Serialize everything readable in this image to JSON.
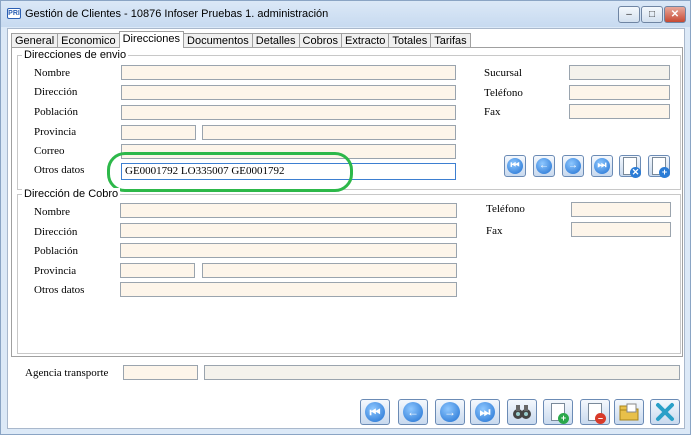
{
  "window": {
    "title": "Gestión de Clientes - 10876 Infoser Pruebas 1. administración",
    "app_icon": "PRI"
  },
  "tabs": [
    "General",
    "Economico",
    "Direcciones",
    "Documentos",
    "Detalles",
    "Cobros",
    "Extracto",
    "Totales",
    "Tarifas"
  ],
  "active_tab": "Direcciones",
  "envio": {
    "title": "Direcciones de envio",
    "labels": {
      "nombre": "Nombre",
      "direccion": "Dirección",
      "poblacion": "Población",
      "provincia": "Provincia",
      "correo": "Correo",
      "otros": "Otros datos",
      "sucursal": "Sucursal",
      "telefono": "Teléfono",
      "fax": "Fax"
    },
    "otros_value": "GE0001792 LO335007 GE0001792"
  },
  "cobro": {
    "title": "Dirección de Cobro",
    "labels": {
      "nombre": "Nombre",
      "direccion": "Dirección",
      "poblacion": "Población",
      "provincia": "Provincia",
      "otros": "Otros datos",
      "telefono": "Teléfono",
      "fax": "Fax"
    }
  },
  "agencia": {
    "label": "Agencia transporte"
  },
  "nav_icons": {
    "first": "⏮",
    "prev": "←",
    "next": "→",
    "last": "⏭"
  },
  "colors": {
    "highlight": "#2db84a",
    "field_bg": "#fdf5ea",
    "accent": "#1e6fd1"
  }
}
